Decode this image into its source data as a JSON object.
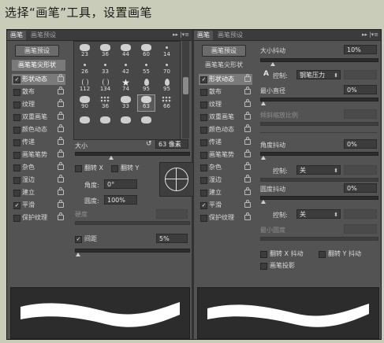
{
  "caption": "选择“画笔”工具，设置画笔",
  "panels": {
    "left": {
      "tabs": [
        "画笔",
        "画笔预设"
      ],
      "tab_controls": "▸▸ |▾≡",
      "preset_button": "画笔预设",
      "list_header": "画笔笔尖形状",
      "items": [
        {
          "label": "形状动态",
          "checked": true
        },
        {
          "label": "散布",
          "checked": false
        },
        {
          "label": "纹理",
          "checked": false
        },
        {
          "label": "双重画笔",
          "checked": false
        },
        {
          "label": "颜色动态",
          "checked": false
        },
        {
          "label": "传递",
          "checked": false
        },
        {
          "label": "画笔笔势",
          "checked": false
        },
        {
          "label": "杂色",
          "checked": false
        },
        {
          "label": "湿边",
          "checked": false
        },
        {
          "label": "建立",
          "checked": false
        },
        {
          "label": "平滑",
          "checked": true
        },
        {
          "label": "保护纹理",
          "checked": false
        }
      ],
      "check_mark": "✓",
      "tips": [
        [
          "23",
          "36",
          "44",
          "60",
          "14"
        ],
        [
          "26",
          "33",
          "42",
          "55",
          "70"
        ],
        [
          "112",
          "134",
          "74",
          "95",
          "95"
        ],
        [
          "90",
          "36",
          "33",
          "63",
          "66"
        ]
      ],
      "selected_tip": "63",
      "size_label": "大小",
      "size_value": "63 像素",
      "flip_x_label": "翻转 X",
      "flip_y_label": "翻转 Y",
      "angle_label": "角度:",
      "angle_value": "0°",
      "roundness_label": "圆度:",
      "roundness_value": "100%",
      "hardness_label": "硬度",
      "spacing_label": "间距",
      "spacing_checked": true,
      "spacing_value": "5%"
    },
    "right": {
      "tabs": [
        "画笔",
        "画笔预设"
      ],
      "tab_controls": "▸▸ |▾≡",
      "preset_button": "画笔预设",
      "list_header": "画笔笔尖形状",
      "items": [
        {
          "label": "形状动态",
          "checked": true
        },
        {
          "label": "散布",
          "checked": false
        },
        {
          "label": "纹理",
          "checked": false
        },
        {
          "label": "双重画笔",
          "checked": false
        },
        {
          "label": "颜色动态",
          "checked": false
        },
        {
          "label": "传递",
          "checked": false
        },
        {
          "label": "画笔笔势",
          "checked": false
        },
        {
          "label": "杂色",
          "checked": false
        },
        {
          "label": "湿边",
          "checked": false
        },
        {
          "label": "建立",
          "checked": false
        },
        {
          "label": "平滑",
          "checked": true
        },
        {
          "label": "保护纹理",
          "checked": false
        }
      ],
      "check_mark": "✓",
      "size_jitter_label": "大小抖动",
      "size_jitter_value": "10%",
      "control_label": "控制:",
      "control_value_1": "钢笔压力",
      "min_diameter_label": "最小直径",
      "min_diameter_value": "0%",
      "tilt_scale_label": "倾斜缩放比例",
      "angle_jitter_label": "角度抖动",
      "angle_jitter_value": "0%",
      "control_value_2": "关",
      "roundness_jitter_label": "圆度抖动",
      "roundness_jitter_value": "0%",
      "control_value_3": "关",
      "min_roundness_label": "最小圆度",
      "flip_x_jitter_label": "翻转 X 抖动",
      "flip_y_jitter_label": "翻转 Y 抖动",
      "brush_projection_label": "画笔投影",
      "warn_icon": "A"
    }
  },
  "colors": {
    "page_bg": "#c9ccb8",
    "panel_bg": "#535353",
    "selected_row": "#7a7a7a",
    "field_bg": "#3c3c3c",
    "stroke": "#ffffff"
  }
}
